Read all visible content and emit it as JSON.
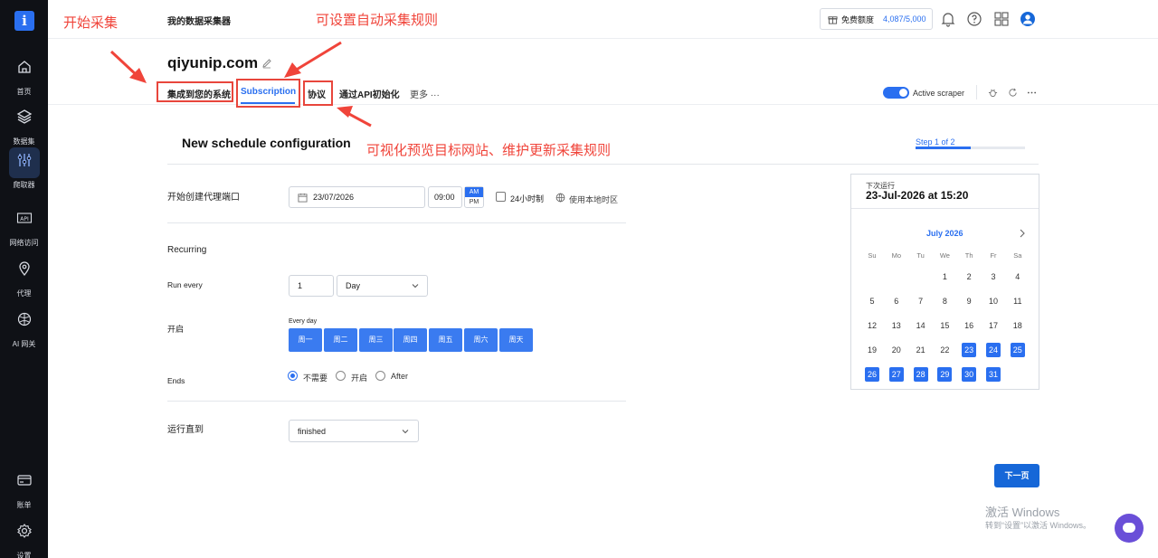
{
  "sidebar": {
    "logo": "i",
    "items": [
      {
        "label": "首页",
        "icon": "home-icon"
      },
      {
        "label": "数据集",
        "icon": "layers-icon"
      },
      {
        "label": "爬取器",
        "icon": "crawler-icon"
      },
      {
        "label": "网络访问",
        "icon": "api-icon"
      },
      {
        "label": "代理",
        "icon": "location-pin-icon"
      },
      {
        "label": "AI 网关",
        "icon": "ai-brain-icon"
      },
      {
        "label": "账单",
        "icon": "billing-card-icon"
      },
      {
        "label": "设置",
        "icon": "gear-icon"
      }
    ]
  },
  "header": {
    "app_title": "我的数据采集器",
    "credits_label": "免费额度",
    "credits_value": "4,087/5,000",
    "credits_icon": "gift-icon",
    "icons": [
      "bell-icon",
      "help-icon",
      "apps-grid-icon",
      "user-avatar-icon"
    ]
  },
  "annotations": {
    "start_collect": "开始采集",
    "auto_rules": "可设置自动采集规则",
    "preview_rules": "可视化预览目标网站、维护更新采集规则",
    "color": "#f0443a"
  },
  "site": {
    "title": "qiyunip.com",
    "tabs": [
      {
        "label": "集成到您的系统"
      },
      {
        "label": "Subscription",
        "active": true
      },
      {
        "label": "协议"
      },
      {
        "label": "通过API初始化"
      },
      {
        "label": "更多 ···"
      }
    ],
    "active_scraper_label": "Active scraper"
  },
  "config": {
    "title": "New schedule configuration",
    "step": "Step 1 of 2",
    "step_progress": 0.5,
    "start_label": "开始创建代理端口",
    "date": "23/07/2026",
    "time": "09:00",
    "am": "AM",
    "pm": "PM",
    "clock24": "24小时制",
    "local_tz": "使用本地时区",
    "recurring": "Recurring",
    "run_every_label": "Run every",
    "run_every_value": "1",
    "run_every_unit": "Day",
    "enable_label": "开启",
    "every_day": "Every day",
    "days": [
      "周一",
      "周二",
      "周三",
      "周四",
      "周五",
      "周六",
      "周天"
    ],
    "ends_label": "Ends",
    "ends_options": [
      "不需要",
      "开启",
      "After"
    ],
    "ends_selected": "不需要",
    "run_until_label": "运行直到",
    "run_until_value": "finished",
    "next_button": "下一页"
  },
  "calendar": {
    "next_run_label": "下次运行",
    "next_run_value": "23-Jul-2026 at 15:20",
    "month": "July 2026",
    "dow": [
      "Su",
      "Mo",
      "Tu",
      "We",
      "Th",
      "Fr",
      "Sa"
    ],
    "first_weekday": 3,
    "days_in_month": 31,
    "selected_from": 23
  },
  "watermark": {
    "line1": "激活 Windows",
    "line2": "转到“设置”以激活 Windows。"
  },
  "colors": {
    "accent": "#2a6ff0",
    "sidebar_bg": "#0f1116",
    "primary_button": "#1667d8"
  }
}
